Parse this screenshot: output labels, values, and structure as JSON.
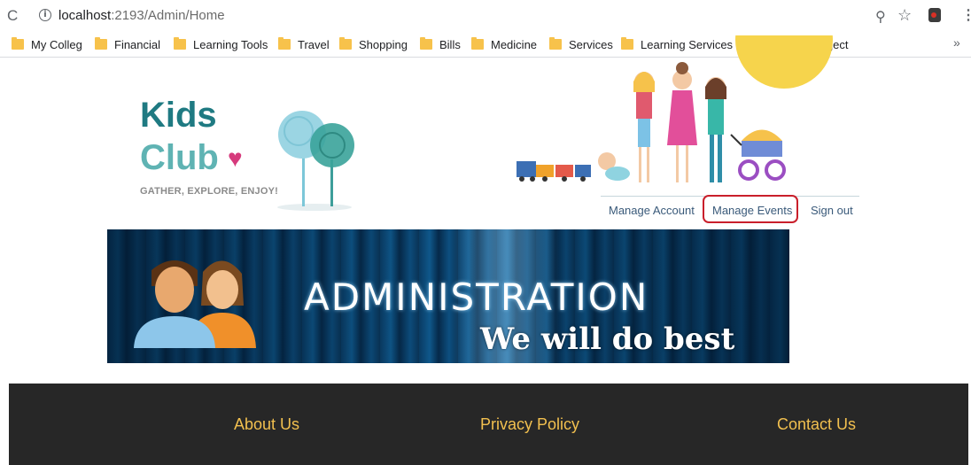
{
  "browser": {
    "url_host": "localhost",
    "url_path": ":2193/Admin/Home",
    "bookmarks": [
      {
        "label": "My Colleg",
        "icon": "folder-icon"
      },
      {
        "label": "Financial",
        "icon": "folder-icon"
      },
      {
        "label": "Learning Tools",
        "icon": "folder-icon"
      },
      {
        "label": "Travel",
        "icon": "folder-icon"
      },
      {
        "label": "Shopping",
        "icon": "folder-icon"
      },
      {
        "label": "Bills",
        "icon": "folder-icon"
      },
      {
        "label": "Medicine",
        "icon": "folder-icon"
      },
      {
        "label": "Services",
        "icon": "folder-icon"
      },
      {
        "label": "Learning Services",
        "icon": "folder-icon"
      },
      {
        "label": "",
        "icon": "youtube-icon"
      },
      {
        "label": "",
        "icon": "google-translate-icon"
      },
      {
        "label": "Project",
        "icon": "folder-icon"
      }
    ],
    "more_label": "»"
  },
  "header": {
    "logo_line1": "Kids",
    "logo_line2": "Club",
    "tagline": "GATHER, EXPLORE, ENJOY!"
  },
  "nav": {
    "manage_account": "Manage Account",
    "manage_events": "Manage Events",
    "sign_out": "Sign out"
  },
  "banner": {
    "title": "ADMINISTRATION",
    "subtitle": "We will do best"
  },
  "footer": {
    "about": "About Us",
    "privacy": "Privacy Policy",
    "contact": "Contact Us"
  },
  "colors": {
    "logo_dark": "#1f7a82",
    "logo_light": "#5fb3b3",
    "footer_bg": "#272727",
    "footer_link": "#f2c04f",
    "highlight": "#c91f2b"
  }
}
